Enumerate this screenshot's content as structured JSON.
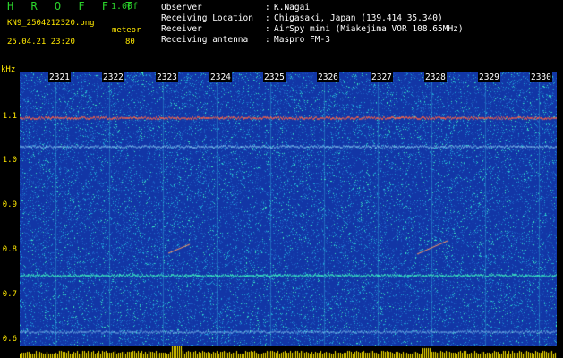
{
  "header": {
    "logo": "HROFFT",
    "version": "1.00f",
    "filename": "KN9_2504212320.png",
    "meteor_label": "meteor",
    "datetime": "25.04.21 23:20",
    "meteor_count": "80",
    "info": [
      {
        "key": "Observer",
        "value": "K.Nagai"
      },
      {
        "key": "Receiving Location",
        "value": "Chigasaki, Japan (139.414 35.340)"
      },
      {
        "key": "Receiver",
        "value": "AirSpy mini (Miakejima VOR 108.65MHz)"
      },
      {
        "key": "Receiving antenna",
        "value": "Maspro FM-3"
      }
    ]
  },
  "spectrogram": {
    "y_unit": "kHz",
    "y_ticks": [
      "1.1",
      "1.0",
      "0.9",
      "0.8",
      "0.7",
      "0.6"
    ],
    "x_ticks": [
      "2321",
      "2322",
      "2323",
      "2324",
      "2325",
      "2326",
      "2327",
      "2328",
      "2329",
      "2330"
    ],
    "colors": {
      "background": "#1236a6",
      "noise_light": "#1fa8d8",
      "noise_hot": "#3cf0c0",
      "signal": "#ffe800",
      "bars": "#ffe800"
    }
  }
}
